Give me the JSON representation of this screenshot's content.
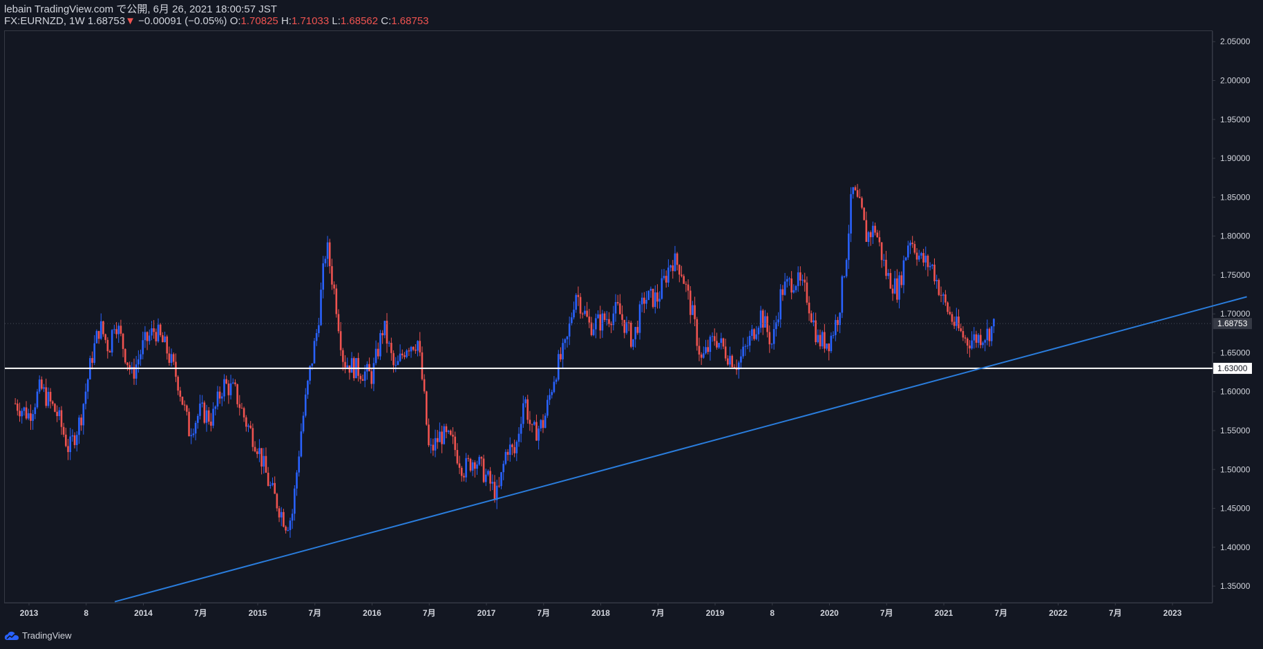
{
  "header": {
    "line1": "lebain TradingView.com で公開, 6月 26, 2021 18:00:57 JST",
    "symbol": "FX:EURNZD, 1W 1.68753",
    "arrow": "▼",
    "change": "−0.00091 (−0.05%)",
    "o_label": "O:",
    "o_value": "1.70825",
    "h_label": "H:",
    "h_value": "1.71033",
    "l_label": "L:",
    "l_value": "1.68562",
    "c_label": "C:",
    "c_value": "1.68753"
  },
  "footer": {
    "brand": "TradingView"
  },
  "colors": {
    "background": "#131722",
    "up": "#2962ff",
    "down": "#ef5350",
    "trendline": "#2a7ddd",
    "hline": "#ffffff",
    "axis_text": "#d1d4dc"
  },
  "chart_data": {
    "type": "candlestick",
    "interval": "1W",
    "ylim": [
      1.32,
      2.06
    ],
    "y_ticks": [
      "1.35000",
      "1.40000",
      "1.45000",
      "1.50000",
      "1.55000",
      "1.60000",
      "1.65000",
      "1.70000",
      "1.75000",
      "1.80000",
      "1.85000",
      "1.90000",
      "1.95000",
      "2.00000",
      "2.05000"
    ],
    "x_range": [
      "2012-11",
      "2023-09"
    ],
    "x_ticks": [
      {
        "label": "2013",
        "t": 2013.0
      },
      {
        "label": "8",
        "t": 2013.5
      },
      {
        "label": "2014",
        "t": 2014.0
      },
      {
        "label": "7月",
        "t": 2014.5
      },
      {
        "label": "2015",
        "t": 2015.0
      },
      {
        "label": "7月",
        "t": 2015.5
      },
      {
        "label": "2016",
        "t": 2016.0
      },
      {
        "label": "7月",
        "t": 2016.5
      },
      {
        "label": "2017",
        "t": 2017.0
      },
      {
        "label": "7月",
        "t": 2017.5
      },
      {
        "label": "2018",
        "t": 2018.0
      },
      {
        "label": "7月",
        "t": 2018.5
      },
      {
        "label": "2019",
        "t": 2019.0
      },
      {
        "label": "8",
        "t": 2019.5
      },
      {
        "label": "2020",
        "t": 2020.0
      },
      {
        "label": "7月",
        "t": 2020.5
      },
      {
        "label": "2021",
        "t": 2021.0
      },
      {
        "label": "7月",
        "t": 2021.5
      },
      {
        "label": "2022",
        "t": 2022.0
      },
      {
        "label": "7月",
        "t": 2022.5
      },
      {
        "label": "2023",
        "t": 2023.0
      }
    ],
    "last_price": "1.68753",
    "last_price_value": 1.68753,
    "horizontal_line": {
      "value": 1.63,
      "label": "1.63000"
    },
    "trendline": {
      "start": {
        "t": 2013.75,
        "price": 1.33
      },
      "end": {
        "t": 2023.65,
        "price": 1.722
      }
    },
    "closes": [
      {
        "t": 2012.88,
        "c": 1.585
      },
      {
        "t": 2013.0,
        "c": 1.57
      },
      {
        "t": 2013.1,
        "c": 1.605
      },
      {
        "t": 2013.25,
        "c": 1.57
      },
      {
        "t": 2013.35,
        "c": 1.525
      },
      {
        "t": 2013.45,
        "c": 1.565
      },
      {
        "t": 2013.55,
        "c": 1.645
      },
      {
        "t": 2013.62,
        "c": 1.685
      },
      {
        "t": 2013.7,
        "c": 1.655
      },
      {
        "t": 2013.75,
        "c": 1.695
      },
      {
        "t": 2013.82,
        "c": 1.66
      },
      {
        "t": 2013.9,
        "c": 1.62
      },
      {
        "t": 2014.0,
        "c": 1.66
      },
      {
        "t": 2014.1,
        "c": 1.68
      },
      {
        "t": 2014.2,
        "c": 1.655
      },
      {
        "t": 2014.3,
        "c": 1.615
      },
      {
        "t": 2014.4,
        "c": 1.55
      },
      {
        "t": 2014.5,
        "c": 1.575
      },
      {
        "t": 2014.6,
        "c": 1.565
      },
      {
        "t": 2014.7,
        "c": 1.61
      },
      {
        "t": 2014.8,
        "c": 1.6
      },
      {
        "t": 2014.9,
        "c": 1.56
      },
      {
        "t": 2015.0,
        "c": 1.53
      },
      {
        "t": 2015.1,
        "c": 1.48
      },
      {
        "t": 2015.25,
        "c": 1.43
      },
      {
        "t": 2015.3,
        "c": 1.44
      },
      {
        "t": 2015.38,
        "c": 1.55
      },
      {
        "t": 2015.45,
        "c": 1.62
      },
      {
        "t": 2015.52,
        "c": 1.68
      },
      {
        "t": 2015.6,
        "c": 1.79
      },
      {
        "t": 2015.68,
        "c": 1.72
      },
      {
        "t": 2015.75,
        "c": 1.64
      },
      {
        "t": 2015.85,
        "c": 1.63
      },
      {
        "t": 2016.0,
        "c": 1.62
      },
      {
        "t": 2016.1,
        "c": 1.685
      },
      {
        "t": 2016.2,
        "c": 1.625
      },
      {
        "t": 2016.3,
        "c": 1.66
      },
      {
        "t": 2016.4,
        "c": 1.665
      },
      {
        "t": 2016.45,
        "c": 1.6
      },
      {
        "t": 2016.5,
        "c": 1.52
      },
      {
        "t": 2016.6,
        "c": 1.545
      },
      {
        "t": 2016.7,
        "c": 1.535
      },
      {
        "t": 2016.8,
        "c": 1.5
      },
      {
        "t": 2016.9,
        "c": 1.515
      },
      {
        "t": 2017.0,
        "c": 1.49
      },
      {
        "t": 2017.1,
        "c": 1.465
      },
      {
        "t": 2017.18,
        "c": 1.53
      },
      {
        "t": 2017.25,
        "c": 1.52
      },
      {
        "t": 2017.33,
        "c": 1.595
      },
      {
        "t": 2017.4,
        "c": 1.545
      },
      {
        "t": 2017.5,
        "c": 1.56
      },
      {
        "t": 2017.6,
        "c": 1.625
      },
      {
        "t": 2017.7,
        "c": 1.66
      },
      {
        "t": 2017.78,
        "c": 1.73
      },
      {
        "t": 2017.9,
        "c": 1.685
      },
      {
        "t": 2018.0,
        "c": 1.69
      },
      {
        "t": 2018.15,
        "c": 1.705
      },
      {
        "t": 2018.28,
        "c": 1.665
      },
      {
        "t": 2018.38,
        "c": 1.72
      },
      {
        "t": 2018.5,
        "c": 1.72
      },
      {
        "t": 2018.62,
        "c": 1.77
      },
      {
        "t": 2018.7,
        "c": 1.76
      },
      {
        "t": 2018.8,
        "c": 1.7
      },
      {
        "t": 2018.88,
        "c": 1.64
      },
      {
        "t": 2019.0,
        "c": 1.67
      },
      {
        "t": 2019.1,
        "c": 1.65
      },
      {
        "t": 2019.2,
        "c": 1.635
      },
      {
        "t": 2019.3,
        "c": 1.665
      },
      {
        "t": 2019.4,
        "c": 1.7
      },
      {
        "t": 2019.5,
        "c": 1.66
      },
      {
        "t": 2019.58,
        "c": 1.73
      },
      {
        "t": 2019.7,
        "c": 1.745
      },
      {
        "t": 2019.8,
        "c": 1.725
      },
      {
        "t": 2019.9,
        "c": 1.665
      },
      {
        "t": 2020.0,
        "c": 1.665
      },
      {
        "t": 2020.08,
        "c": 1.7
      },
      {
        "t": 2020.15,
        "c": 1.78
      },
      {
        "t": 2020.2,
        "c": 1.86
      },
      {
        "t": 2020.28,
        "c": 1.83
      },
      {
        "t": 2020.32,
        "c": 1.8
      },
      {
        "t": 2020.4,
        "c": 1.81
      },
      {
        "t": 2020.5,
        "c": 1.75
      },
      {
        "t": 2020.6,
        "c": 1.73
      },
      {
        "t": 2020.7,
        "c": 1.8
      },
      {
        "t": 2020.8,
        "c": 1.77
      },
      {
        "t": 2020.9,
        "c": 1.76
      },
      {
        "t": 2021.0,
        "c": 1.715
      },
      {
        "t": 2021.1,
        "c": 1.685
      },
      {
        "t": 2021.2,
        "c": 1.665
      },
      {
        "t": 2021.3,
        "c": 1.67
      },
      {
        "t": 2021.38,
        "c": 1.675
      },
      {
        "t": 2021.45,
        "c": 1.687
      }
    ]
  }
}
